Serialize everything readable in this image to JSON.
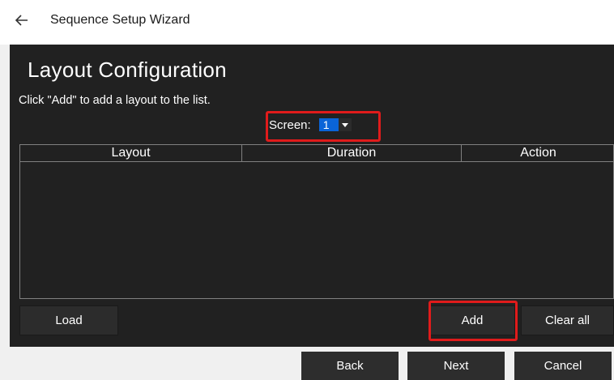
{
  "window": {
    "title": "Sequence Setup Wizard",
    "back_icon": "back-arrow-icon"
  },
  "main": {
    "heading": "Layout Configuration",
    "instruction": "Click \"Add\" to add a layout to the list.",
    "screen": {
      "label": "Screen:",
      "value": "1"
    },
    "table": {
      "columns": [
        "Layout",
        "Duration",
        "Action"
      ],
      "rows": []
    },
    "buttons": {
      "load": "Load",
      "add": "Add",
      "clear_all": "Clear all"
    }
  },
  "footer": {
    "back": "Back",
    "next": "Next",
    "cancel": "Cancel"
  },
  "colors": {
    "panel_bg": "#212121",
    "highlight": "#e01b1b",
    "selection": "#0a64d8"
  }
}
